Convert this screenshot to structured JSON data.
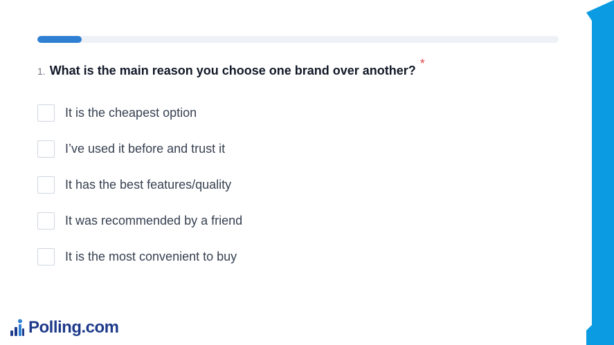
{
  "progress": {
    "fraction": 0.085
  },
  "question": {
    "number": "1.",
    "text": "What is the main reason you choose one brand over another?",
    "required_mark": "*"
  },
  "options": [
    {
      "label": "It is the cheapest option"
    },
    {
      "label": "I’ve used it before and trust it"
    },
    {
      "label": "It has the best features/quality"
    },
    {
      "label": "It was recommended by a friend"
    },
    {
      "label": "It is the most convenient to buy"
    }
  ],
  "branding": {
    "logo_text": "Polling.com",
    "logo_icon": "bar-chart-person-icon"
  },
  "colors": {
    "accent": "#2f7fd3",
    "side_band": "#0a9be3",
    "required": "#e5484d",
    "logo": "#1e3a8a"
  }
}
